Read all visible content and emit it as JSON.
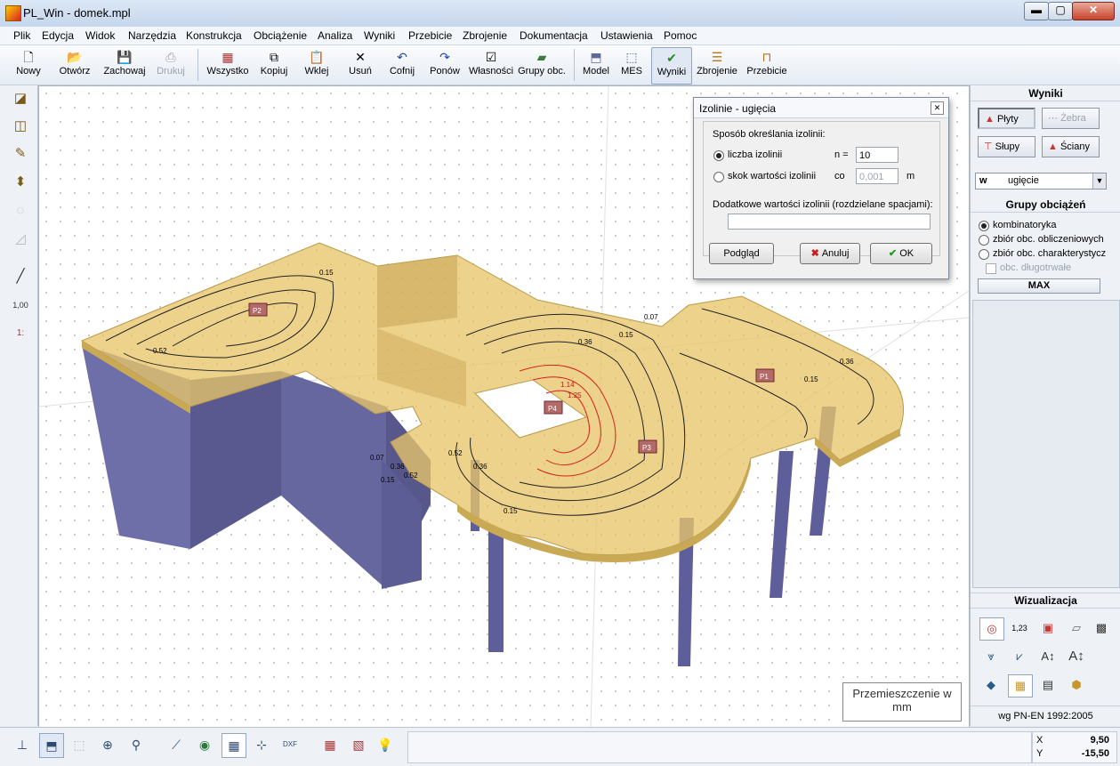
{
  "window": {
    "title": "PL_Win - domek.mpl",
    "min_label": "▬",
    "max_label": "▢",
    "close_label": "✕"
  },
  "menu": [
    "Plik",
    "Edycja",
    "Widok",
    "Narzędzia",
    "Konstrukcja",
    "Obciążenie",
    "Analiza",
    "Wyniki",
    "Przebicie",
    "Zbrojenie",
    "Dokumentacja",
    "Ustawienia",
    "Pomoc"
  ],
  "toolbar": {
    "nowy": "Nowy",
    "otworz": "Otwórz",
    "zachowaj": "Zachowaj",
    "drukuj": "Drukuj",
    "wszystko": "Wszystko",
    "kopiuj": "Kopiuj",
    "wklej": "Wklej",
    "usun": "Usuń",
    "cofnij": "Cofnij",
    "ponow": "Ponów",
    "wlasnosci": "Własności",
    "grupy": "Grupy obc.",
    "model": "Model",
    "mes": "MES",
    "wyniki": "Wyniki",
    "zbrojenie": "Zbrojenie",
    "przebicie": "Przebicie"
  },
  "left_toolbar": {
    "tool7_label": "1,00",
    "tool8_label": "1:"
  },
  "viewport": {
    "legend_line1": "Przemieszczenie  w",
    "legend_line2": "mm",
    "contour_labels": [
      "0.15",
      "0.52",
      "0.36",
      "0.07",
      "0.15",
      "0.36",
      "0.15",
      "0.36",
      "0.52",
      "0.07",
      "0.15",
      "0.15",
      "1.14",
      "1.25",
      "0.36",
      "0.52"
    ],
    "slab_tags": [
      "P2",
      "P1",
      "P3",
      "P4"
    ]
  },
  "dialog": {
    "title": "Izolinie - ugięcia",
    "close_label": "✕",
    "method_label": "Sposób określania izolinii:",
    "opt_count_label": "liczba izolinii",
    "n_label": "n =",
    "n_value": "10",
    "opt_step_label": "skok wartości izolinii",
    "co_label": "co",
    "step_value": "0,001",
    "m_label": "m",
    "extra_label": "Dodatkowe wartości izolinii (rozdzielane spacjami):",
    "extra_value": "",
    "preview_label": "Podgląd",
    "cancel_label": "Anuluj",
    "ok_label": "OK"
  },
  "right_panel": {
    "wyniki_title": "Wyniki",
    "plyty": "Płyty",
    "zebra": "Żebra",
    "slupy": "Słupy",
    "sciany": "Ściany",
    "select_key": "w",
    "select_value": "ugięcie",
    "groups_title": "Grupy obciążeń",
    "opt_kombinatoryka": "kombinatoryka",
    "opt_obliczeniowych": "zbiór obc. obliczeniowych",
    "opt_charakterystycz": "zbiór obc. charakterystycz",
    "chk_dlugotrwale": "obc. długotrwałe",
    "max_label": "MAX",
    "vis_title": "Wizualizacja",
    "vis_ic2": "1,23",
    "norm": "wg PN-EN 1992:2005"
  },
  "status": {
    "x_label": "X",
    "x_value": "9,50",
    "y_label": "Y",
    "y_value": "-15,50"
  }
}
